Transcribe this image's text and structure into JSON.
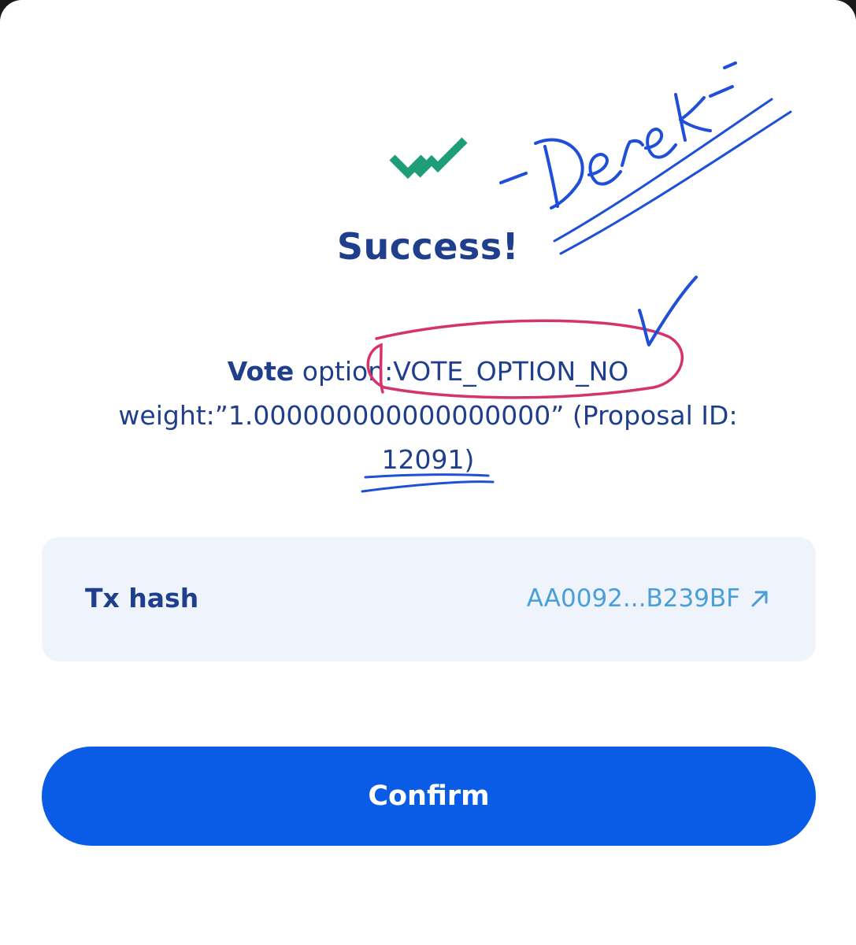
{
  "dialog": {
    "title": "Success!",
    "message": {
      "vote_label": "Vote",
      "option_text": " option:VOTE_OPTION_NO",
      "weight_text": "weight:”1.000000000000000000” (Proposal ID:",
      "proposal_text": "12091)"
    },
    "tx": {
      "label": "Tx hash",
      "value": "AA0092...B239BF"
    },
    "confirm_label": "Confirm"
  },
  "annotations": {
    "signature": "-Derek-"
  },
  "icons": {
    "success": "double-check-icon",
    "external_link": "arrow-up-right-icon"
  },
  "colors": {
    "primary_text": "#1f3f8c",
    "accent_button": "#0a5ce6",
    "success_icon": "#1e9e78",
    "link": "#4a9fd8",
    "card_bg": "#eff3fb",
    "pen_blue": "#1f4fd8",
    "pen_red": "#d6336c"
  }
}
